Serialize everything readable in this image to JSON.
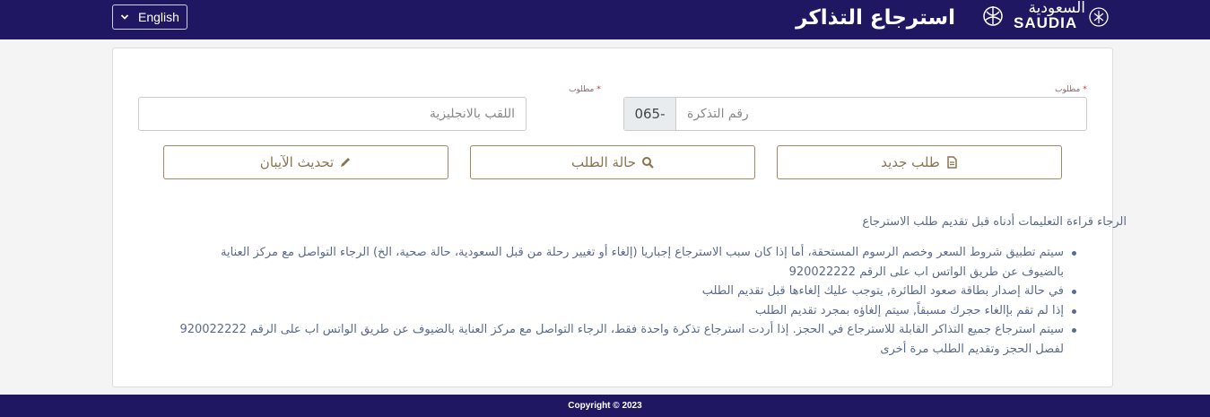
{
  "header": {
    "language_label": "English",
    "page_title": "استرجاع التذاكر",
    "logo": {
      "arabic": "السعودية",
      "english": "SAUDIA"
    },
    "background_color": "#1f1761"
  },
  "form": {
    "ticket_number": {
      "required_label": "مطلوب",
      "required_mark": "*",
      "prefix": "065-",
      "placeholder": "رقم التذكرة"
    },
    "surname": {
      "required_label": "مطلوب",
      "required_mark": "*",
      "placeholder": "اللقب بالانجليزية"
    }
  },
  "buttons": {
    "new_request": "طلب جديد",
    "request_status": "حالة الطلب",
    "update_iban": "تحديث الآيبان",
    "border_color": "#a0885f"
  },
  "instructions": {
    "intro": "الرجاء قراءة التعليمات أدناه قبل تقديم طلب الاسترجاع",
    "items": [
      "سيتم تطبيق شروط السعر وخصم الرسوم المستحقة، أما إذا كان سبب الاسترجاع إجباريا (إلغاء أو تغيير رحلة من قبل السعودية، حالة صحية، الخ) الرجاء التواصل مع مركز العناية بالضيوف عن طريق الواتس اب على الرقم 920022222",
      "في حالة إصدار بطاقة صعود الطائرة, يتوجب عليك إلغاءها قبل تقديم الطلب",
      "إذا لم تقم بإالغاء حجرك مسبقاً, سيتم إلغاؤه بمجرد تقديم الطلب",
      "سيتم استرجاع جميع التذاكر القابلة للاسترجاع في الحجز. إذا أردت استرجاع تذكرة واحدة فقط، الرجاء التواصل مع مركز العناية بالضيوف عن طريق الواتس اب على الرقم 920022222 لفصل الحجز وتقديم الطلب مرة أخرى"
    ]
  },
  "footer": {
    "copyright": "Copyright © 2023"
  },
  "icons": [
    "chevron-down-icon",
    "file-icon",
    "search-icon",
    "pencil-icon",
    "saudia-emblem-icon"
  ]
}
